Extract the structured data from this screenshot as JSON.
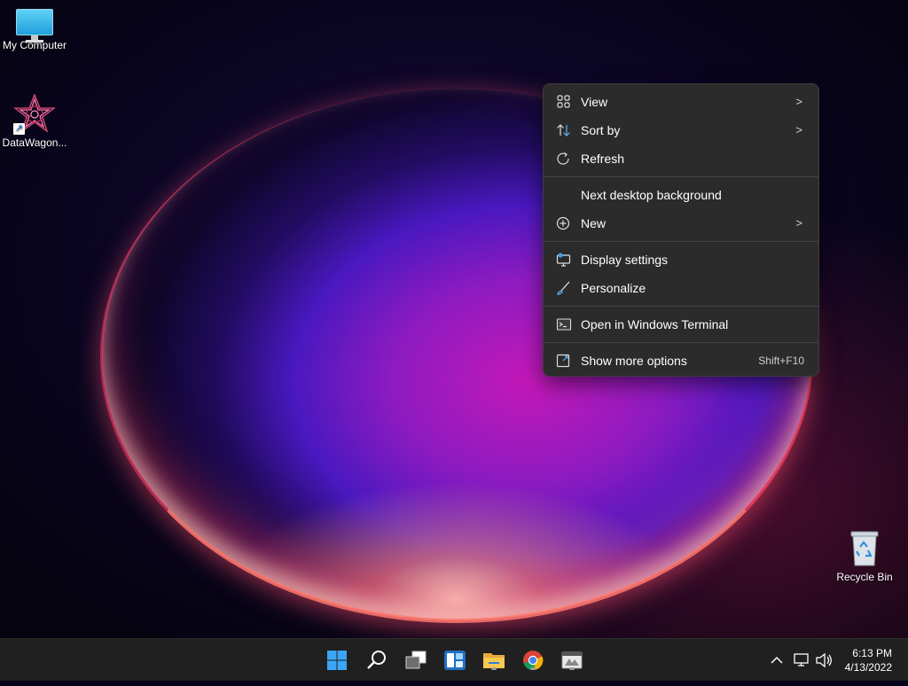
{
  "desktop": {
    "icons": [
      {
        "label": "My Computer"
      },
      {
        "label": "DataWagon..."
      },
      {
        "label": "Recycle Bin"
      }
    ]
  },
  "context_menu": {
    "items": [
      {
        "label": "View",
        "icon": "grid-icon",
        "submenu": true
      },
      {
        "label": "Sort by",
        "icon": "sort-icon",
        "submenu": true
      },
      {
        "label": "Refresh",
        "icon": "refresh-icon"
      },
      {
        "label": "Next desktop background"
      },
      {
        "label": "New",
        "icon": "plus-circle-icon",
        "submenu": true
      },
      {
        "label": "Display settings",
        "icon": "display-settings-icon"
      },
      {
        "label": "Personalize",
        "icon": "brush-icon"
      },
      {
        "label": "Open in Windows Terminal",
        "icon": "terminal-icon"
      },
      {
        "label": "Show more options",
        "icon": "expand-icon",
        "shortcut": "Shift+F10"
      }
    ],
    "chevron": ">"
  },
  "taskbar": {
    "apps": [
      "start-icon",
      "search-icon",
      "task-view-icon",
      "widgets-icon",
      "file-explorer-icon",
      "chrome-icon",
      "app-icon"
    ],
    "tray": {
      "overflow": "^",
      "time": "6:13 PM",
      "date": "4/13/2022"
    }
  },
  "colors": {
    "menu_bg": "#2b2b2b",
    "taskbar_bg": "#202020",
    "accent": "#3aa0f0"
  }
}
